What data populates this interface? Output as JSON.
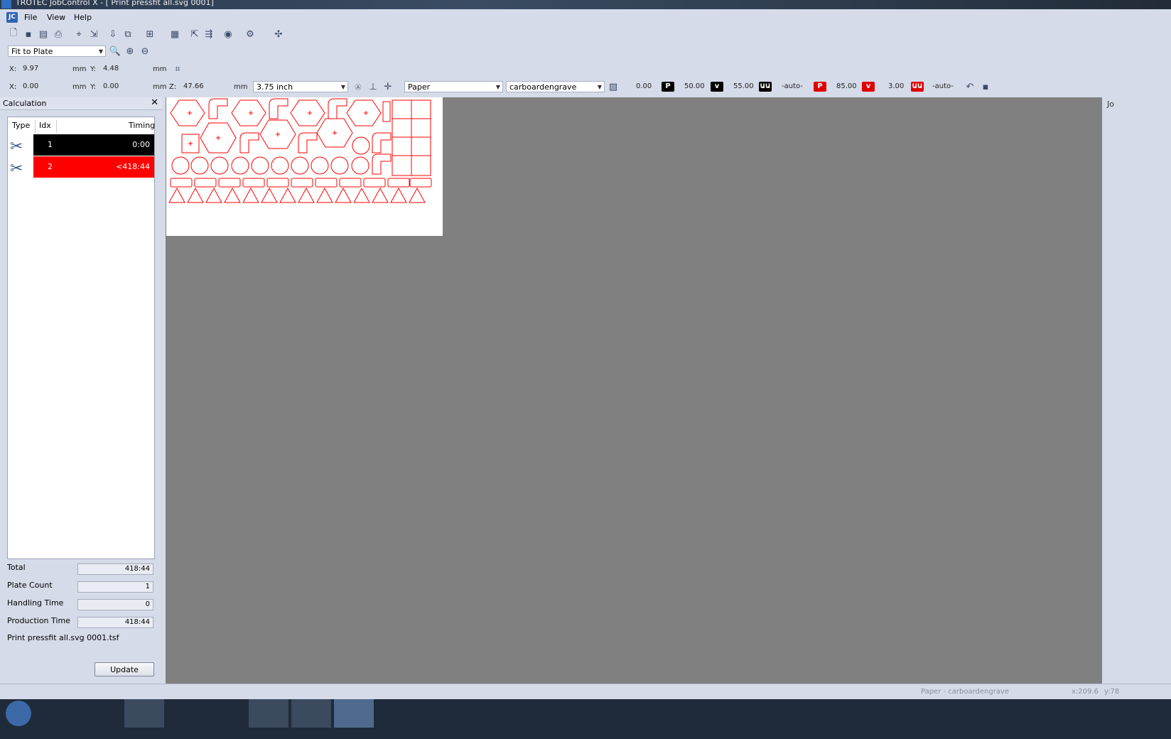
{
  "window": {
    "title": "TROTEC JobControl X - [ Print pressfit all.svg 0001]"
  },
  "menu": {
    "items": [
      "File",
      "View",
      "Help"
    ]
  },
  "zoom": {
    "selected": "Fit to Plate"
  },
  "position": {
    "x_label": "X:",
    "x_value": "9.97",
    "x_unit": "mm",
    "y_label": "Y:",
    "y_value": "4.48",
    "y_unit": "mm"
  },
  "offset": {
    "x_label": "X:",
    "x_value": "0.00",
    "x_unit": "mm",
    "y_label": "Y:",
    "y_value": "0.00",
    "y_unit": "mm",
    "z_label": "Z:",
    "z_value": "47.66",
    "z_unit": "mm",
    "lens": "3.75 inch"
  },
  "material": {
    "group": "Paper",
    "name": "carboardengrave",
    "engrave_value": "0.00",
    "power1": "50.00",
    "speed1": "55.00",
    "freq1": "-auto-",
    "power2": "85.00",
    "speed2": "3.00",
    "freq2": "-auto-",
    "badge_p": "P",
    "badge_v": "v"
  },
  "calc_panel": {
    "title": "Calculation",
    "close": "✕",
    "headers": {
      "type": "Type",
      "idx": "Idx",
      "timing": "Timing"
    },
    "rows": [
      {
        "idx": "1",
        "timing": "0:00",
        "color": "#000000"
      },
      {
        "idx": "2",
        "timing": "<418:44",
        "color": "#ff0000"
      }
    ],
    "summary": {
      "total_label": "Total",
      "total": "418:44",
      "plate_count_label": "Plate Count",
      "plate_count": "1",
      "handling_label": "Handling Time",
      "handling": "0",
      "production_label": "Production Time",
      "production": "418:44"
    },
    "filename": "Print pressfit all.svg 0001.tsf",
    "update_button": "Update"
  },
  "right_tab": "Jo",
  "status": {
    "material": "Paper - carboardengrave",
    "coord_x": "x:209.6",
    "coord_y": "y:78"
  },
  "colors": {
    "cut": "#ff0000",
    "engrave": "#000000",
    "workspace": "#808080",
    "chrome": "#d6dbe9"
  }
}
